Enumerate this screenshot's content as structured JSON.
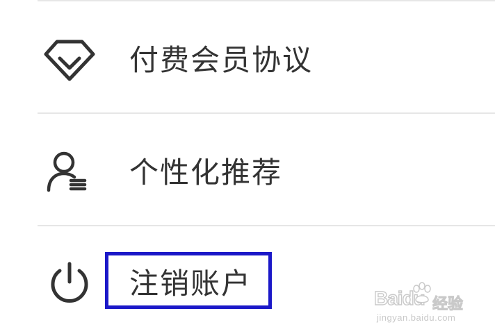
{
  "menu": {
    "items": [
      {
        "label": "付费会员协议",
        "icon": "diamond-icon"
      },
      {
        "label": "个性化推荐",
        "icon": "user-profile-icon"
      },
      {
        "label": "注销账户",
        "icon": "power-icon"
      }
    ]
  },
  "highlight": {
    "color": "#1b18c8"
  },
  "colors": {
    "text": "#333333",
    "divider": "#e6e6e6",
    "icon": "#333333"
  },
  "watermark": {
    "brand": "Baidu",
    "sub": "经验",
    "url": "jingyan.baidu.com"
  }
}
